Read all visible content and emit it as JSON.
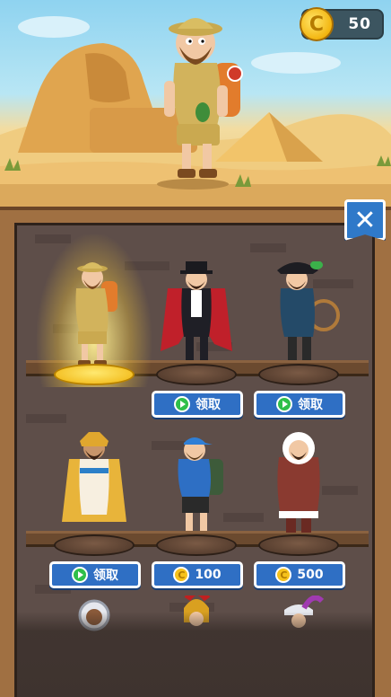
{
  "currency": {
    "icon": "coin-icon",
    "symbol": "C",
    "amount": "50"
  },
  "hero": {
    "name": "explorer-outfit-character"
  },
  "wardrobe": {
    "close_icon": "close-icon",
    "close_glyph": "✕",
    "outfits": [
      {
        "id": "explorer",
        "state": "equipped",
        "label": ""
      },
      {
        "id": "vampire",
        "action": "ad",
        "label": "领取"
      },
      {
        "id": "pirate",
        "action": "ad",
        "label": "领取"
      },
      {
        "id": "pharaoh",
        "action": "ad",
        "label": "领取"
      },
      {
        "id": "hiker",
        "action": "coins",
        "label": "100"
      },
      {
        "id": "eskimo",
        "action": "coins",
        "label": "500"
      },
      {
        "id": "astronaut",
        "action": "locked",
        "label": ""
      },
      {
        "id": "spartan",
        "action": "locked",
        "label": ""
      },
      {
        "id": "musketeer",
        "action": "locked",
        "label": ""
      }
    ],
    "coin_symbol": "C"
  },
  "colors": {
    "button_blue": "#2f6fc4",
    "ad_green": "#2fbf4a",
    "coin_gold": "#f6c21c",
    "panel_wood": "#a07042"
  }
}
